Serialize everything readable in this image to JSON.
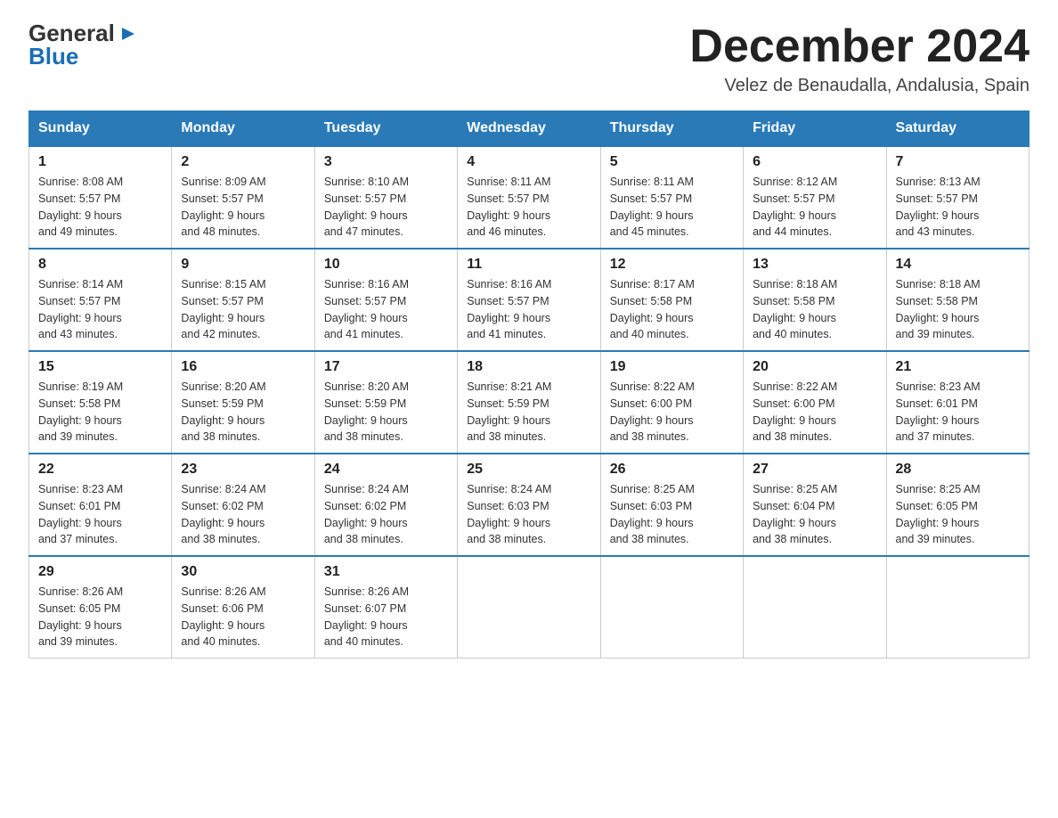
{
  "logo": {
    "general": "General",
    "blue": "Blue",
    "triangle": "▶"
  },
  "title": "December 2024",
  "location": "Velez de Benaudalla, Andalusia, Spain",
  "weekdays": [
    "Sunday",
    "Monday",
    "Tuesday",
    "Wednesday",
    "Thursday",
    "Friday",
    "Saturday"
  ],
  "weeks": [
    [
      {
        "day": "1",
        "sunrise": "8:08 AM",
        "sunset": "5:57 PM",
        "daylight": "9 hours and 49 minutes."
      },
      {
        "day": "2",
        "sunrise": "8:09 AM",
        "sunset": "5:57 PM",
        "daylight": "9 hours and 48 minutes."
      },
      {
        "day": "3",
        "sunrise": "8:10 AM",
        "sunset": "5:57 PM",
        "daylight": "9 hours and 47 minutes."
      },
      {
        "day": "4",
        "sunrise": "8:11 AM",
        "sunset": "5:57 PM",
        "daylight": "9 hours and 46 minutes."
      },
      {
        "day": "5",
        "sunrise": "8:11 AM",
        "sunset": "5:57 PM",
        "daylight": "9 hours and 45 minutes."
      },
      {
        "day": "6",
        "sunrise": "8:12 AM",
        "sunset": "5:57 PM",
        "daylight": "9 hours and 44 minutes."
      },
      {
        "day": "7",
        "sunrise": "8:13 AM",
        "sunset": "5:57 PM",
        "daylight": "9 hours and 43 minutes."
      }
    ],
    [
      {
        "day": "8",
        "sunrise": "8:14 AM",
        "sunset": "5:57 PM",
        "daylight": "9 hours and 43 minutes."
      },
      {
        "day": "9",
        "sunrise": "8:15 AM",
        "sunset": "5:57 PM",
        "daylight": "9 hours and 42 minutes."
      },
      {
        "day": "10",
        "sunrise": "8:16 AM",
        "sunset": "5:57 PM",
        "daylight": "9 hours and 41 minutes."
      },
      {
        "day": "11",
        "sunrise": "8:16 AM",
        "sunset": "5:57 PM",
        "daylight": "9 hours and 41 minutes."
      },
      {
        "day": "12",
        "sunrise": "8:17 AM",
        "sunset": "5:58 PM",
        "daylight": "9 hours and 40 minutes."
      },
      {
        "day": "13",
        "sunrise": "8:18 AM",
        "sunset": "5:58 PM",
        "daylight": "9 hours and 40 minutes."
      },
      {
        "day": "14",
        "sunrise": "8:18 AM",
        "sunset": "5:58 PM",
        "daylight": "9 hours and 39 minutes."
      }
    ],
    [
      {
        "day": "15",
        "sunrise": "8:19 AM",
        "sunset": "5:58 PM",
        "daylight": "9 hours and 39 minutes."
      },
      {
        "day": "16",
        "sunrise": "8:20 AM",
        "sunset": "5:59 PM",
        "daylight": "9 hours and 38 minutes."
      },
      {
        "day": "17",
        "sunrise": "8:20 AM",
        "sunset": "5:59 PM",
        "daylight": "9 hours and 38 minutes."
      },
      {
        "day": "18",
        "sunrise": "8:21 AM",
        "sunset": "5:59 PM",
        "daylight": "9 hours and 38 minutes."
      },
      {
        "day": "19",
        "sunrise": "8:22 AM",
        "sunset": "6:00 PM",
        "daylight": "9 hours and 38 minutes."
      },
      {
        "day": "20",
        "sunrise": "8:22 AM",
        "sunset": "6:00 PM",
        "daylight": "9 hours and 38 minutes."
      },
      {
        "day": "21",
        "sunrise": "8:23 AM",
        "sunset": "6:01 PM",
        "daylight": "9 hours and 37 minutes."
      }
    ],
    [
      {
        "day": "22",
        "sunrise": "8:23 AM",
        "sunset": "6:01 PM",
        "daylight": "9 hours and 37 minutes."
      },
      {
        "day": "23",
        "sunrise": "8:24 AM",
        "sunset": "6:02 PM",
        "daylight": "9 hours and 38 minutes."
      },
      {
        "day": "24",
        "sunrise": "8:24 AM",
        "sunset": "6:02 PM",
        "daylight": "9 hours and 38 minutes."
      },
      {
        "day": "25",
        "sunrise": "8:24 AM",
        "sunset": "6:03 PM",
        "daylight": "9 hours and 38 minutes."
      },
      {
        "day": "26",
        "sunrise": "8:25 AM",
        "sunset": "6:03 PM",
        "daylight": "9 hours and 38 minutes."
      },
      {
        "day": "27",
        "sunrise": "8:25 AM",
        "sunset": "6:04 PM",
        "daylight": "9 hours and 38 minutes."
      },
      {
        "day": "28",
        "sunrise": "8:25 AM",
        "sunset": "6:05 PM",
        "daylight": "9 hours and 39 minutes."
      }
    ],
    [
      {
        "day": "29",
        "sunrise": "8:26 AM",
        "sunset": "6:05 PM",
        "daylight": "9 hours and 39 minutes."
      },
      {
        "day": "30",
        "sunrise": "8:26 AM",
        "sunset": "6:06 PM",
        "daylight": "9 hours and 40 minutes."
      },
      {
        "day": "31",
        "sunrise": "8:26 AM",
        "sunset": "6:07 PM",
        "daylight": "9 hours and 40 minutes."
      },
      null,
      null,
      null,
      null
    ]
  ],
  "labels": {
    "sunrise": "Sunrise:",
    "sunset": "Sunset:",
    "daylight": "Daylight:"
  }
}
